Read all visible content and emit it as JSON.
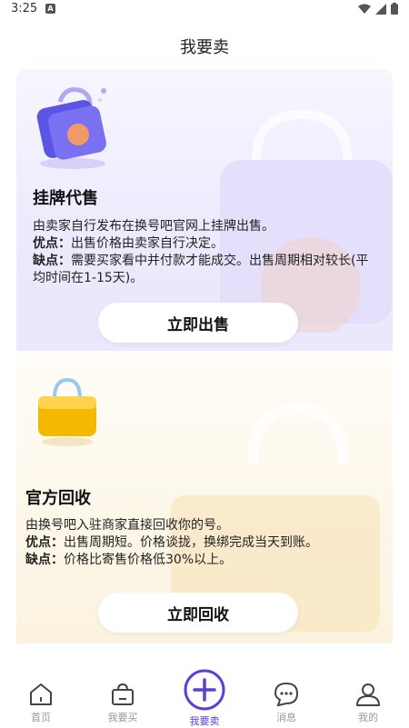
{
  "status_bar": {
    "time": "3:25",
    "notification_letter": "A"
  },
  "header": {
    "title": "我要卖"
  },
  "listing_card": {
    "title": "挂牌代售",
    "line1": "由卖家自行发布在换号吧官网上挂牌出售。",
    "pros_label": "优点：",
    "pros": "出售价格由卖家自行决定。",
    "cons_label": "缺点：",
    "cons": "需要买家看中并付款才能成交。出售周期相对较长(平均时间在1-15天)。",
    "button_label": "立即出售",
    "accent_color": "#6a5cf0"
  },
  "recycle_card": {
    "title": "官方回收",
    "line1": "由换号吧入驻商家直接回收你的号。",
    "pros_label": "优点：",
    "pros": "出售周期短。价格谈拢，换绑完成当天到账。",
    "cons_label": "缺点：",
    "cons": "价格比寄售价格低30%以上。",
    "button_label": "立即回收",
    "accent_color": "#f5b800"
  },
  "nav": {
    "items": [
      {
        "label": "首页",
        "icon": "home-icon"
      },
      {
        "label": "我要买",
        "icon": "shopping-bag-icon"
      },
      {
        "label": "我要卖",
        "icon": "plus-circle-icon"
      },
      {
        "label": "消息",
        "icon": "chat-bubble-icon"
      },
      {
        "label": "我的",
        "icon": "user-icon"
      }
    ],
    "active_index": 2,
    "active_color": "#5b3fd6"
  }
}
